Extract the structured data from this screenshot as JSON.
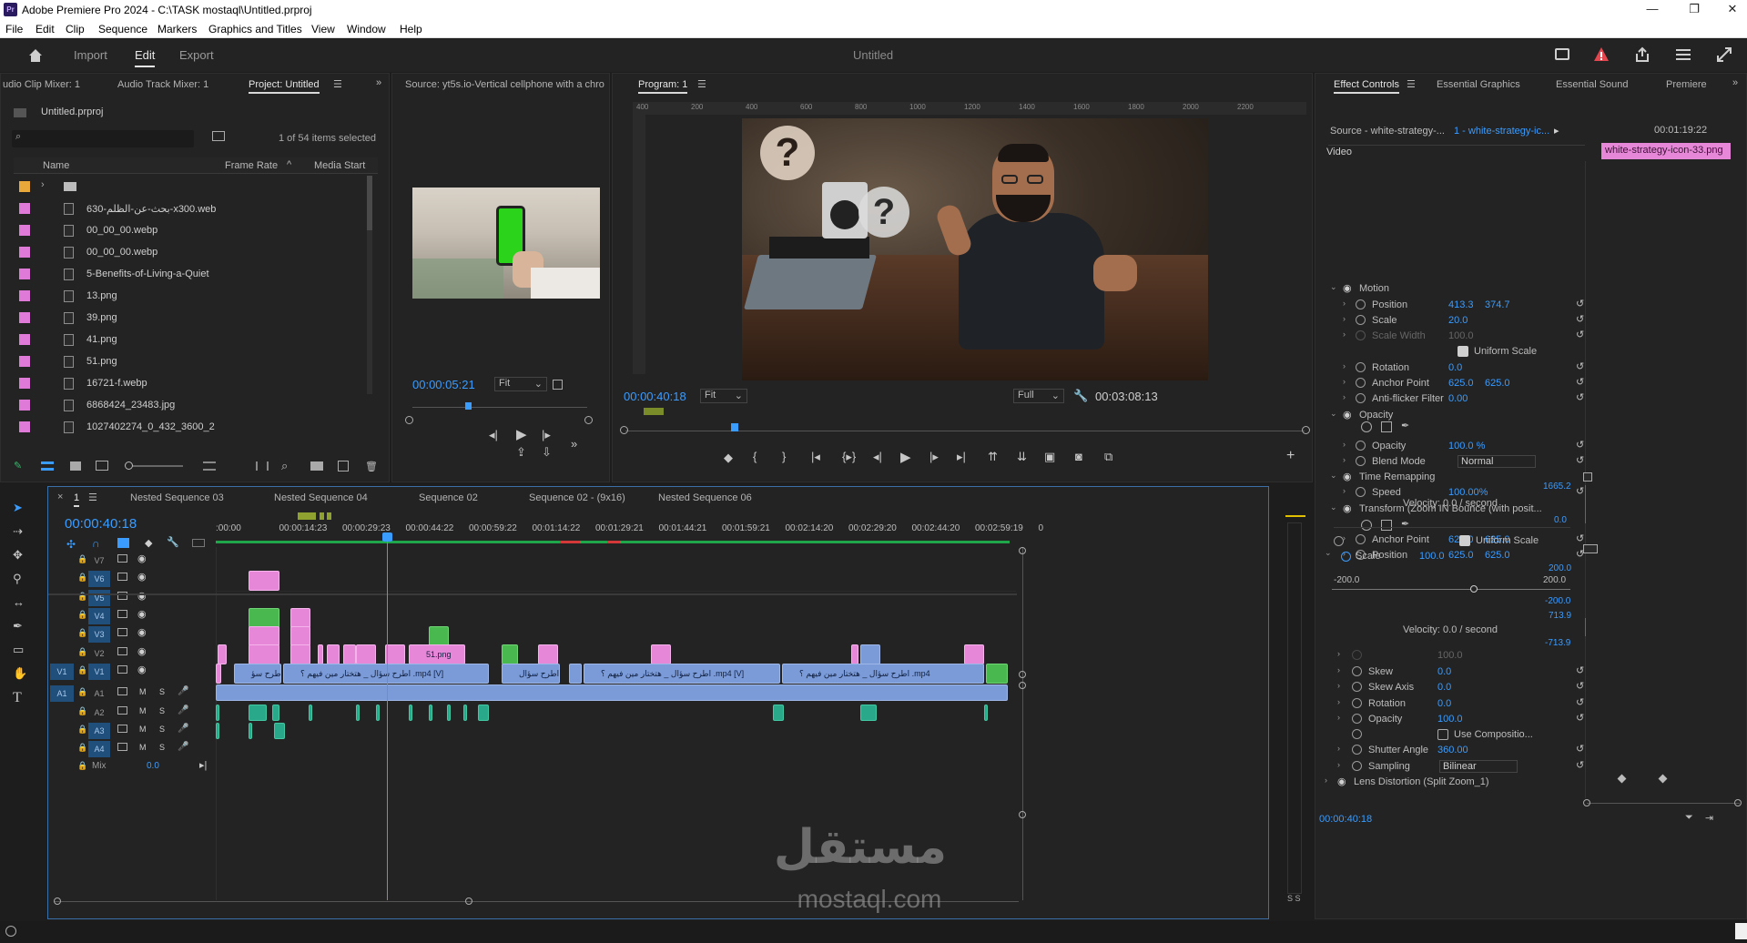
{
  "window": {
    "app_icon": "Pr",
    "title": "Adobe Premiere Pro 2024 - C:\\TASK mostaql\\Untitled.prproj",
    "controls": [
      "—",
      "❐",
      "✕"
    ]
  },
  "menu": [
    "File",
    "Edit",
    "Clip",
    "Sequence",
    "Markers",
    "Graphics and Titles",
    "View",
    "Window",
    "Help"
  ],
  "workspace": {
    "tabs": [
      "Import",
      "Edit",
      "Export"
    ],
    "active": "Edit",
    "doc_title": "Untitled"
  },
  "left_panel": {
    "tabs": [
      "udio Clip Mixer: 1",
      "Audio Track Mixer: 1",
      "Project: Untitled"
    ],
    "project_file": "Untitled.prproj",
    "search_placeholder": "",
    "selection_status": "1 of 54 items selected",
    "columns": [
      "Name",
      "Frame Rate",
      "Media Start"
    ],
    "items": [
      {
        "name": "",
        "type": "folder",
        "color": "#e8a83a"
      },
      {
        "name": "630-بحث-عن-الظلم-x300.web",
        "type": "file",
        "color": "#e07ad9"
      },
      {
        "name": "00_00_00.webp",
        "type": "file",
        "color": "#e07ad9"
      },
      {
        "name": "00_00_00.webp",
        "type": "file",
        "color": "#e07ad9"
      },
      {
        "name": "5-Benefits-of-Living-a-Quiet",
        "type": "file",
        "color": "#e07ad9"
      },
      {
        "name": "13.png",
        "type": "file",
        "color": "#e07ad9"
      },
      {
        "name": "39.png",
        "type": "file",
        "color": "#e07ad9"
      },
      {
        "name": "41.png",
        "type": "file",
        "color": "#e07ad9"
      },
      {
        "name": "51.png",
        "type": "file",
        "color": "#e07ad9"
      },
      {
        "name": "16721-f.webp",
        "type": "file",
        "color": "#e07ad9"
      },
      {
        "name": "6868424_23483.jpg",
        "type": "file",
        "color": "#e07ad9"
      },
      {
        "name": "1027402274_0_432_3600_2",
        "type": "file",
        "color": "#e07ad9"
      }
    ]
  },
  "source_monitor": {
    "tab": "Source: yt5s.io-Vertical cellphone with a chro",
    "timecode": "00:00:05:21",
    "fit": "Fit"
  },
  "program_monitor": {
    "tab": "Program: 1",
    "ruler_labels": [
      "400",
      "200",
      "400",
      "600",
      "800",
      "1000",
      "1200",
      "1400",
      "1600",
      "1800",
      "2000",
      "2200"
    ],
    "timecode": "00:00:40:18",
    "fit": "Fit",
    "quality": "Full",
    "duration": "00:03:08:13"
  },
  "effect_controls": {
    "tabs": [
      "Effect Controls",
      "Essential Graphics",
      "Essential Sound",
      "Premiere"
    ],
    "source": "Source - white-strategy-...",
    "clip": "1 - white-strategy-ic...",
    "clip_tc": "00:01:19:22",
    "clip_label": "white-strategy-icon-33.png",
    "section": "Video",
    "rows": [
      {
        "label": "Motion",
        "kind": "header"
      },
      {
        "label": "Position",
        "v1": "413.3",
        "v2": "374.7"
      },
      {
        "label": "Scale",
        "v1": "20.0"
      },
      {
        "label": "Scale Width",
        "v1": "100.0",
        "disabled": true
      },
      {
        "label": "Uniform Scale",
        "kind": "check"
      },
      {
        "label": "Rotation",
        "v1": "0.0"
      },
      {
        "label": "Anchor Point",
        "v1": "625.0",
        "v2": "625.0"
      },
      {
        "label": "Anti-flicker Filter",
        "v1": "0.00"
      },
      {
        "label": "Opacity",
        "kind": "header"
      },
      {
        "label": "Opacity",
        "v1": "100.0 %"
      },
      {
        "label": "Blend Mode",
        "v1": "Normal",
        "kind": "select"
      },
      {
        "label": "Time Remapping",
        "kind": "header"
      },
      {
        "label": "Speed",
        "v1": "100.00%"
      },
      {
        "label": "Transform (Zoom IN Bounce (with posit...",
        "kind": "header"
      },
      {
        "label": "Anchor Point",
        "v1": "625.0",
        "v2": "625.0"
      },
      {
        "label": "Position",
        "v1": "625.0",
        "v2": "625.0"
      }
    ],
    "velocity1": "Velocity: 0.0 / second",
    "graph1_top": "1665.2",
    "graph1_bottom": "0.0",
    "uniform_scale_2": "Uniform Scale",
    "scale2_label": "Scale",
    "scale2_value": "100.0",
    "graph2_top": "200.0",
    "slider_min": "-200.0",
    "slider_max": "200.0",
    "graph2_bottom": "-200.0",
    "graph3_top": "713.9",
    "velocity2": "Velocity: 0.0 / second",
    "graph3_bottom": "-713.9",
    "rows2": [
      {
        "label": "",
        "v1": "100.0",
        "disabled": true
      },
      {
        "label": "Skew",
        "v1": "0.0"
      },
      {
        "label": "Skew Axis",
        "v1": "0.0"
      },
      {
        "label": "Rotation",
        "v1": "0.0"
      },
      {
        "label": "Opacity",
        "v1": "100.0"
      },
      {
        "label": "Use Compositio...",
        "kind": "check"
      },
      {
        "label": "Shutter Angle",
        "v1": "360.00"
      },
      {
        "label": "Sampling",
        "v1": "Bilinear",
        "kind": "select"
      },
      {
        "label": "Lens Distortion (Split Zoom_1)",
        "kind": "header"
      }
    ],
    "footer_tc": "00:00:40:18"
  },
  "timeline": {
    "tabs": [
      "1",
      "Nested Sequence 03",
      "Nested Sequence 04",
      "Sequence 02",
      "Sequence 02 - (9x16)",
      "Nested Sequence 06"
    ],
    "timecode": "00:00:40:18",
    "ruler": [
      ":00:00",
      "00:00:14:23",
      "00:00:29:23",
      "00:00:44:22",
      "00:00:59:22",
      "00:01:14:22",
      "00:01:29:21",
      "00:01:44:21",
      "00:01:59:21",
      "00:02:14:20",
      "00:02:29:20",
      "00:02:44:20",
      "00:02:59:19",
      "0"
    ],
    "video_tracks": [
      "V7",
      "V6",
      "V5",
      "V4",
      "V3",
      "V2",
      "V1"
    ],
    "audio_tracks": [
      "A1",
      "A2",
      "A3",
      "A4"
    ],
    "mix_label": "Mix",
    "mix_value": "0.0",
    "source_v": "V1",
    "source_a": "A1",
    "clip_labels": {
      "v2_png": "51.png",
      "v1_a": "اطرح سؤ",
      "v1_b": "اطرح سؤال _ هتختار مين فيهم ؟ .mp4 [V]",
      "v1_c": "اطرح سؤال",
      "v1_d": "اطرح سؤال _ هتختار مين فيهم ؟ .mp4 [V]",
      "v1_e": "اطرح سؤال _ هتختار مين فيهم ؟ .mp4"
    },
    "ms_letters": [
      "M",
      "S"
    ],
    "corner_label": "S S"
  },
  "watermark": {
    "arabic": "مستقل",
    "latin": "mostaql.com"
  },
  "colors": {
    "accent_blue": "#3a9cff",
    "clip_pink": "#e787d7",
    "clip_green": "#49b84f",
    "clip_blue": "#7b9bd8",
    "audio_teal": "#2aa98a"
  }
}
